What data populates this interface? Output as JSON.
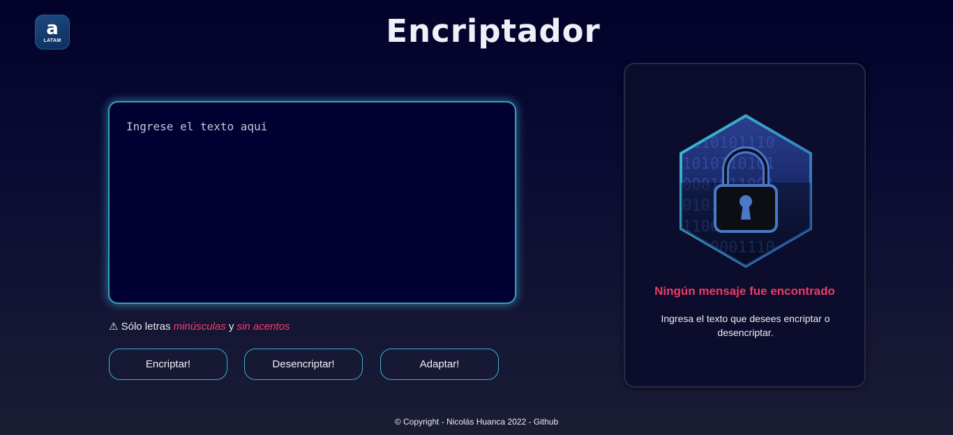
{
  "logo": {
    "glyph": "a",
    "text": "LATAM"
  },
  "header": {
    "title": "Encriptador"
  },
  "input": {
    "placeholder": "Ingrese el texto aqui",
    "value": ""
  },
  "warning": {
    "icon": "warning-icon",
    "prefix": "⚠ Sólo letras ",
    "highlight_1": "minúsculas",
    "middle": " y ",
    "highlight_2": "sin acentos"
  },
  "buttons": {
    "encrypt": "Encriptar!",
    "decrypt": "Desencriptar!",
    "adapt": "Adaptar!"
  },
  "result_panel": {
    "illustration": "padlock-binary-hexagon",
    "title": "Ningún mensaje fue encontrado",
    "description": "Ingresa el texto que desees encriptar o desencriptar."
  },
  "footer": {
    "text": "© Copyright - Nicolás Huanca 2022 - Github"
  },
  "colors": {
    "accent": "#3db2d8",
    "highlight": "#ff3b6b",
    "panel_title": "#f03a63",
    "background": "#02022b"
  }
}
